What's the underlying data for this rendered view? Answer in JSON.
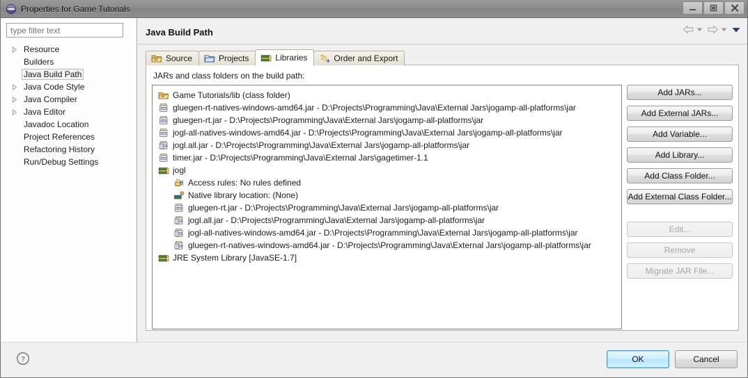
{
  "window": {
    "title": "Properties for Game Tutorials",
    "icon": "eclipse-globe-icon",
    "minimize_label": "Minimize",
    "maximize_label": "Maximize",
    "close_label": "Close"
  },
  "sidebar": {
    "filter": {
      "value": "",
      "placeholder": "type filter text"
    },
    "items": [
      {
        "label": "Resource",
        "expandable": true,
        "selected": false
      },
      {
        "label": "Builders",
        "expandable": false,
        "selected": false
      },
      {
        "label": "Java Build Path",
        "expandable": false,
        "selected": true
      },
      {
        "label": "Java Code Style",
        "expandable": true,
        "selected": false
      },
      {
        "label": "Java Compiler",
        "expandable": true,
        "selected": false
      },
      {
        "label": "Java Editor",
        "expandable": true,
        "selected": false
      },
      {
        "label": "Javadoc Location",
        "expandable": false,
        "selected": false
      },
      {
        "label": "Project References",
        "expandable": false,
        "selected": false
      },
      {
        "label": "Refactoring History",
        "expandable": false,
        "selected": false
      },
      {
        "label": "Run/Debug Settings",
        "expandable": false,
        "selected": false
      }
    ]
  },
  "content": {
    "page_title": "Java Build Path",
    "nav": {
      "back_label": "Back",
      "back_menu_label": "Back history",
      "forward_label": "Forward",
      "forward_menu_label": "Forward history",
      "menu_label": "View menu"
    },
    "tabs": [
      {
        "label": "Source",
        "icon": "source-folder-icon",
        "active": false
      },
      {
        "label": "Projects",
        "icon": "project-folder-icon",
        "active": false
      },
      {
        "label": "Libraries",
        "icon": "libraries-icon",
        "active": true
      },
      {
        "label": "Order and Export",
        "icon": "order-export-icon",
        "active": false
      }
    ],
    "panel_caption": "JARs and class folders on the build path:",
    "entries": [
      {
        "icon": "class-folder-icon",
        "level": 1,
        "label": "Game Tutorials/lib (class folder)"
      },
      {
        "icon": "jar-icon",
        "level": 1,
        "label": "gluegen-rt-natives-windows-amd64.jar - D:\\Projects\\Programming\\Java\\External Jars\\jogamp-all-platforms\\jar"
      },
      {
        "icon": "jar-icon",
        "level": 1,
        "label": "gluegen-rt.jar - D:\\Projects\\Programming\\Java\\External Jars\\jogamp-all-platforms\\jar"
      },
      {
        "icon": "jar-icon",
        "level": 1,
        "label": "jogl-all-natives-windows-amd64.jar - D:\\Projects\\Programming\\Java\\External Jars\\jogamp-all-platforms\\jar"
      },
      {
        "icon": "jar-src-icon",
        "level": 1,
        "label": "jogl.all.jar - D:\\Projects\\Programming\\Java\\External Jars\\jogamp-all-platforms\\jar"
      },
      {
        "icon": "jar-icon",
        "level": 1,
        "label": "timer.jar - D:\\Projects\\Programming\\Java\\External Jars\\gagetimer-1.1"
      },
      {
        "icon": "libraries-icon",
        "level": 1,
        "label": "jogl"
      },
      {
        "icon": "access-rules-icon",
        "level": 2,
        "label": "Access rules: No rules defined"
      },
      {
        "icon": "native-lib-icon",
        "level": 2,
        "label": "Native library location: (None)"
      },
      {
        "icon": "jar-icon",
        "level": 2,
        "label": "gluegen-rt.jar - D:\\Projects\\Programming\\Java\\External Jars\\jogamp-all-platforms\\jar"
      },
      {
        "icon": "jar-src-icon",
        "level": 2,
        "label": "jogl.all.jar - D:\\Projects\\Programming\\Java\\External Jars\\jogamp-all-platforms\\jar"
      },
      {
        "icon": "jar-src-icon",
        "level": 2,
        "label": "jogl-all-natives-windows-amd64.jar - D:\\Projects\\Programming\\Java\\External Jars\\jogamp-all-platforms\\jar"
      },
      {
        "icon": "jar-src-icon",
        "level": 2,
        "label": "gluegen-rt-natives-windows-amd64.jar - D:\\Projects\\Programming\\Java\\External Jars\\jogamp-all-platforms\\jar"
      },
      {
        "icon": "libraries-icon",
        "level": 1,
        "label": "JRE System Library [JavaSE-1.7]"
      }
    ],
    "buttons": [
      {
        "label": "Add JARs...",
        "enabled": true
      },
      {
        "label": "Add External JARs...",
        "enabled": true
      },
      {
        "label": "Add Variable...",
        "enabled": true
      },
      {
        "label": "Add Library...",
        "enabled": true
      },
      {
        "label": "Add Class Folder...",
        "enabled": true
      },
      {
        "label": "Add External Class Folder...",
        "enabled": true
      },
      {
        "label": "Edit...",
        "enabled": false
      },
      {
        "label": "Remove",
        "enabled": false
      },
      {
        "label": "Migrate JAR File...",
        "enabled": false
      }
    ]
  },
  "footer": {
    "help_label": "Help",
    "ok_label": "OK",
    "cancel_label": "Cancel"
  },
  "colors": {
    "titlebar": "#8d8d8d",
    "accent_primary": "#3c9fd6",
    "tab_active_bg": "#ffffff",
    "panel_bg": "#f0f0f0",
    "list_bg": "#ffffff",
    "jar_icon": "#d9b44a",
    "folder_icon": "#e8b84b",
    "library_icon": "#3f7a3f"
  }
}
